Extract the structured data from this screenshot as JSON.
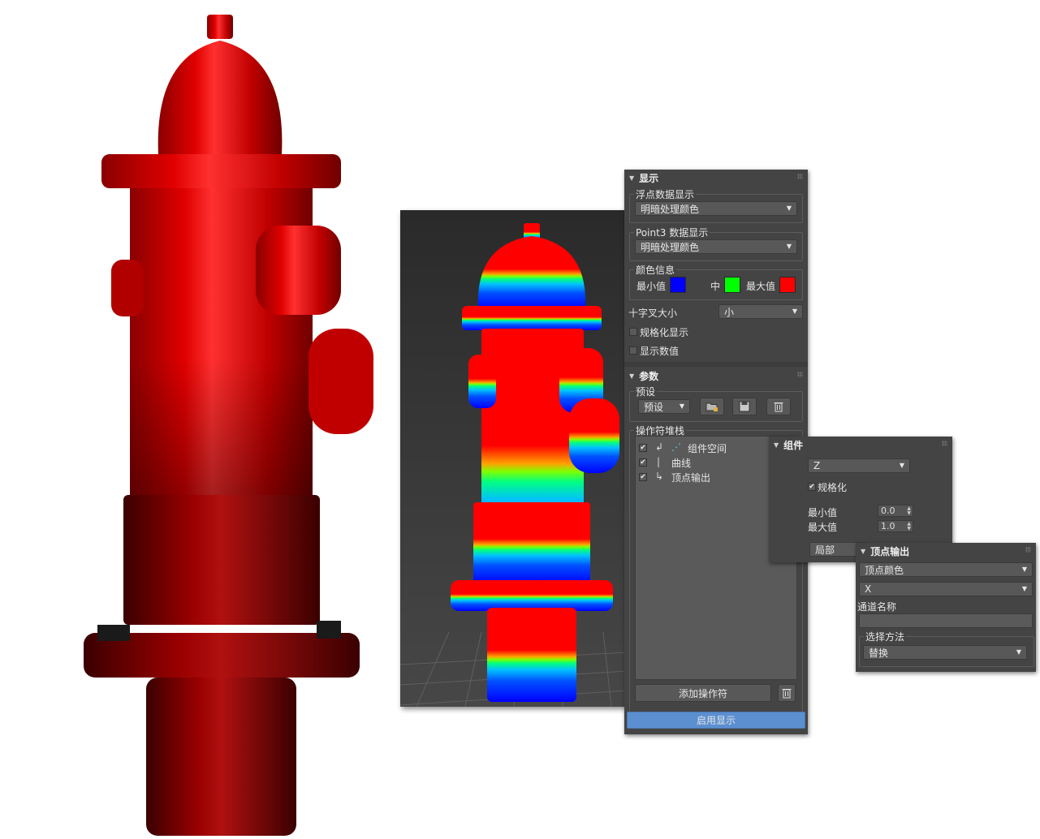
{
  "display": {
    "title": "显示",
    "float_group_label": "浮点数据显示",
    "float_mode": "明暗处理颜色",
    "point3_group_label": "Point3 数据显示",
    "point3_mode": "明暗处理颜色",
    "color_group_label": "颜色信息",
    "min_label": "最小值",
    "mid_label": "中",
    "max_label": "最大值",
    "colors": {
      "min": "#0000ff",
      "mid": "#00ff00",
      "max": "#ff0000"
    },
    "cross_size_label": "十字叉大小",
    "cross_size_value": "小",
    "normalize_display_label": "规格化显示",
    "show_values_label": "显示数值"
  },
  "params": {
    "title": "参数",
    "preset_group_label": "预设",
    "preset_value": "预设",
    "stack_group_label": "操作符堆栈",
    "stack": [
      {
        "label": "组件空间",
        "icon": "component-space-icon"
      },
      {
        "label": "曲线",
        "icon": "curve-icon"
      },
      {
        "label": "顶点输出",
        "icon": "vertex-output-icon"
      }
    ],
    "add_operator_label": "添加操作符",
    "enable_display_label": "启用显示"
  },
  "component": {
    "title": "组件",
    "axis_value": "Z",
    "normalize_label": "规格化",
    "min_label": "最小值",
    "min_value": "0.0",
    "max_label": "最大值",
    "max_value": "1.0",
    "space_value": "局部"
  },
  "vertex_output": {
    "title": "顶点输出",
    "output_type": "顶点颜色",
    "channel": "X",
    "channel_name_label": "通道名称",
    "select_method_label": "选择方法",
    "select_method_value": "替换"
  },
  "accent": "#5b8fd0"
}
